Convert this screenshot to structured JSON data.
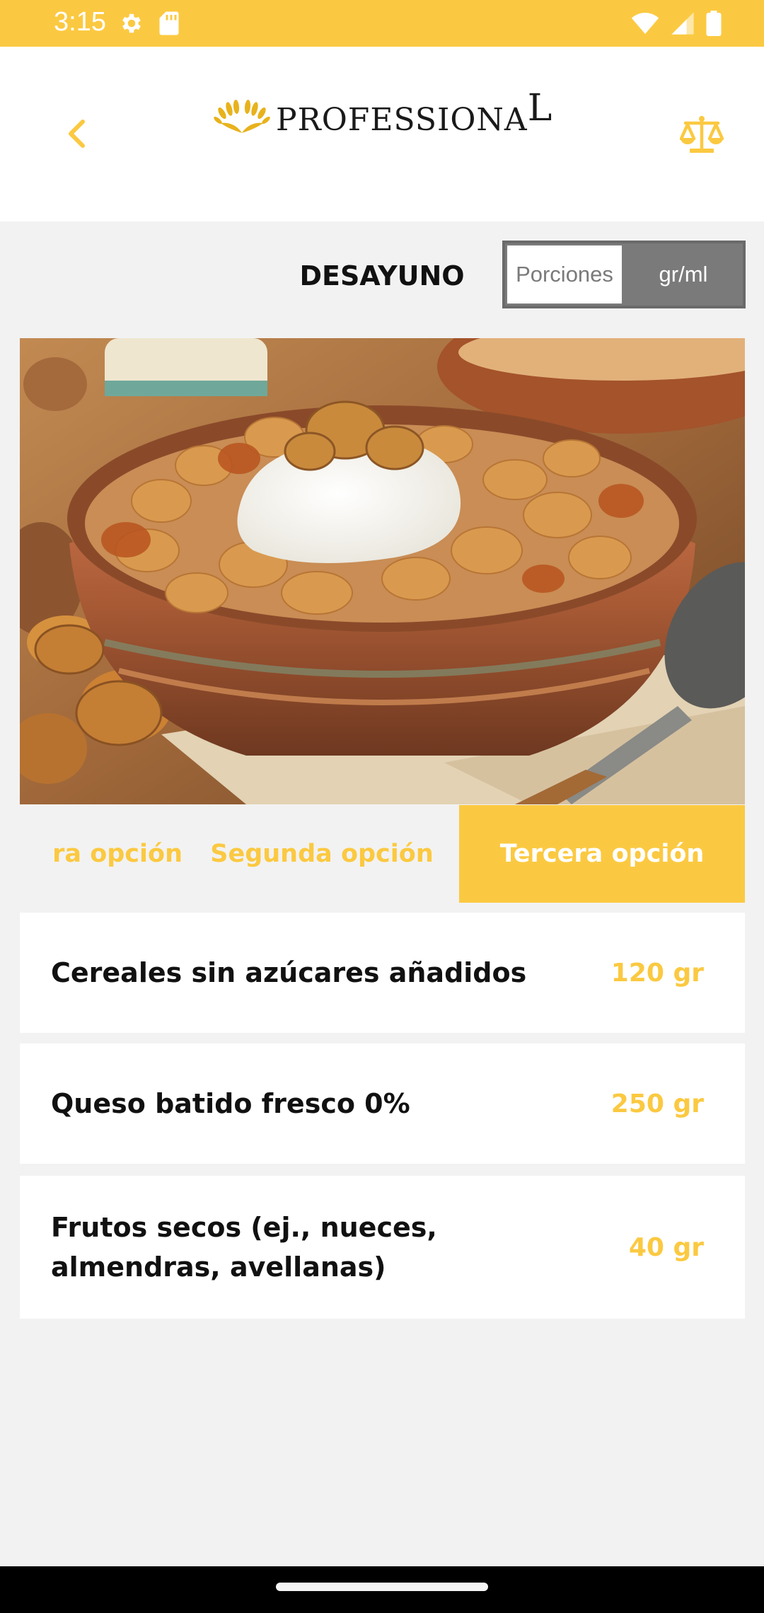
{
  "status_bar": {
    "time": "3:15",
    "left_icons": [
      "settings-icon",
      "sd-card-icon"
    ],
    "right_icons": [
      "wifi-icon",
      "signal-icon",
      "battery-icon"
    ]
  },
  "header": {
    "brand": {
      "name": "PROFESSIONA",
      "trailing_letter": "L"
    },
    "back_icon": "chevron-left-icon",
    "action_icon": "scale-icon"
  },
  "meal": {
    "title": "DESAYUNO"
  },
  "unit_toggle": {
    "options": [
      "Porciones",
      "gr/ml"
    ],
    "selected": "gr/ml"
  },
  "option_tabs": [
    {
      "label": "Primera opción",
      "visible_text": "ra opción",
      "active": false
    },
    {
      "label": "Segunda opción",
      "visible_text": "Segunda opción",
      "active": false
    },
    {
      "label": "Tercera opción",
      "visible_text": "Tercera opción",
      "active": true
    }
  ],
  "food_items": [
    {
      "name": "Cereales sin azúcares añadidos",
      "quantity": "120 gr"
    },
    {
      "name": "Queso batido fresco 0%",
      "quantity": "250 gr"
    },
    {
      "name": "Frutos secos (ej., nueces, almendras, avellanas)",
      "quantity": "40 gr"
    }
  ],
  "colors": {
    "accent": "#fbc941",
    "background": "#f2f2f2",
    "card": "#ffffff",
    "toggle_gray": "#7a7a7a",
    "text": "#111111"
  }
}
